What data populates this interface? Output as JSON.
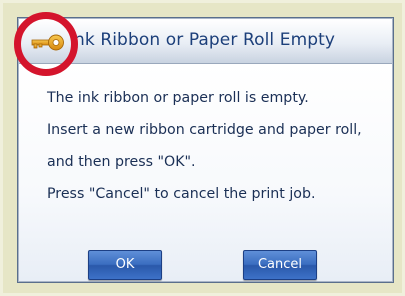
{
  "dialog": {
    "title": "Ink Ribbon or Paper Roll Empty",
    "title_visible": "nk Ribbon or Paper Roll Empty",
    "icon": "key-icon",
    "messages": [
      "The ink ribbon or paper roll is empty.",
      "Insert a new ribbon cartridge and paper roll,",
      "and then press \"OK\".",
      "Press \"Cancel\" to cancel the print job."
    ],
    "ok_label": "OK",
    "cancel_label": "Cancel"
  },
  "colors": {
    "highlight_ring": "#d4142c",
    "key": "#e8a020",
    "button": "#3a6dc0",
    "text": "#1a2f55",
    "title_text": "#1c3f7a",
    "background": "#e6e6c6"
  }
}
